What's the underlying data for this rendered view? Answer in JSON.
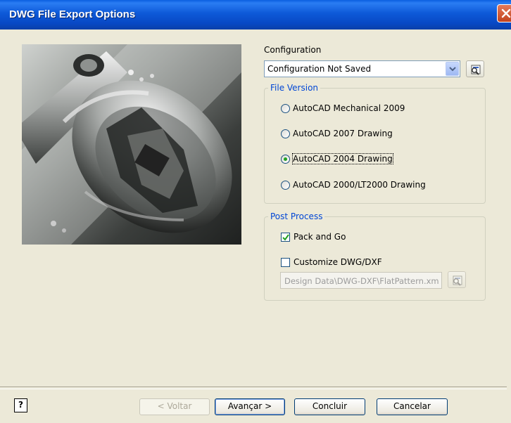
{
  "window": {
    "title": "DWG File Export Options"
  },
  "configuration": {
    "label": "Configuration",
    "selected": "Configuration Not Saved"
  },
  "file_version": {
    "title": "File Version",
    "options": [
      {
        "label": "AutoCAD Mechanical 2009",
        "checked": false
      },
      {
        "label": "AutoCAD 2007 Drawing",
        "checked": false
      },
      {
        "label": "AutoCAD 2004 Drawing",
        "checked": true
      },
      {
        "label": "AutoCAD 2000/LT2000 Drawing",
        "checked": false
      }
    ]
  },
  "post_process": {
    "title": "Post Process",
    "pack_and_go": {
      "label": "Pack and Go",
      "checked": true
    },
    "customize": {
      "label": "Customize DWG/DXF",
      "checked": false
    },
    "path": "Design Data\\DWG-DXF\\FlatPattern.xm"
  },
  "buttons": {
    "help": "?",
    "back": "< Voltar",
    "next": "Avançar >",
    "finish": "Concluir",
    "cancel": "Cancelar"
  },
  "colors": {
    "title_bar": "#0a5ee0",
    "group_title": "#0046d5",
    "dialog_bg": "#ece9d8"
  }
}
